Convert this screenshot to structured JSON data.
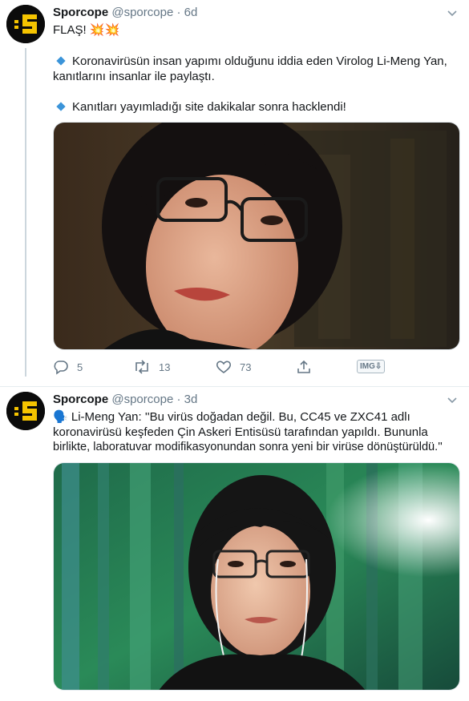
{
  "tweets": [
    {
      "author": {
        "name": "Sporcope",
        "handle": "@sporcope"
      },
      "separator": "·",
      "time": "6d",
      "lines": [
        "FLAŞ! 💥💥",
        "Koronavirüsün insan yapımı olduğunu iddia eden Virolog Li-Meng Yan,",
        "kanıtlarını insanlar ile paylaştı.",
        "Kanıtları yayımladığı site dakikalar sonra hacklendi!"
      ],
      "actions": {
        "replies": "5",
        "retweets": "13",
        "likes": "73"
      },
      "extension_label": "IMG⇩"
    },
    {
      "author": {
        "name": "Sporcope",
        "handle": "@sporcope"
      },
      "separator": "·",
      "time": "3d",
      "emoji": "🗣️",
      "lines": [
        "Li-Meng Yan: ''Bu virüs doğadan değil. Bu, CC45 ve ZXC41 adlı",
        "koronavirüsü keşfeden Çin Askeri Entisüsü tarafından yapıldı. Bununla",
        "birlikte, laboratuvar modifikasyonundan sonra yeni bir virüse dönüştürüldü.''"
      ]
    }
  ],
  "colors": {
    "accent": "#3b94d9",
    "secondary_text": "#657786",
    "avatar_bg": "#0b0b0b",
    "avatar_logo": "#f5c400"
  },
  "icons": {
    "reply": "reply-icon",
    "retweet": "retweet-icon",
    "like": "heart-icon",
    "share": "share-icon",
    "caret": "chevron-down-icon"
  }
}
